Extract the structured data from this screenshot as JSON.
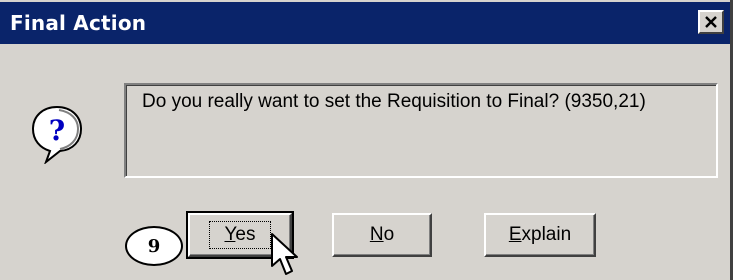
{
  "dialog": {
    "title": "Final Action",
    "close_glyph": "✕",
    "message": "Do you really want to set the Requisition to Final? (9350,21)",
    "icon": "question-balloon-icon"
  },
  "buttons": {
    "yes": {
      "mnemonic": "Y",
      "rest": "es"
    },
    "no": {
      "mnemonic": "N",
      "rest": "o"
    },
    "explain": {
      "mnemonic": "E",
      "rest": "xplain"
    }
  },
  "annotation": {
    "step_number": "9"
  },
  "colors": {
    "titlebar": "#0a246a",
    "dialog_face": "#d6d3ce",
    "icon_blue": "#0000c0"
  }
}
